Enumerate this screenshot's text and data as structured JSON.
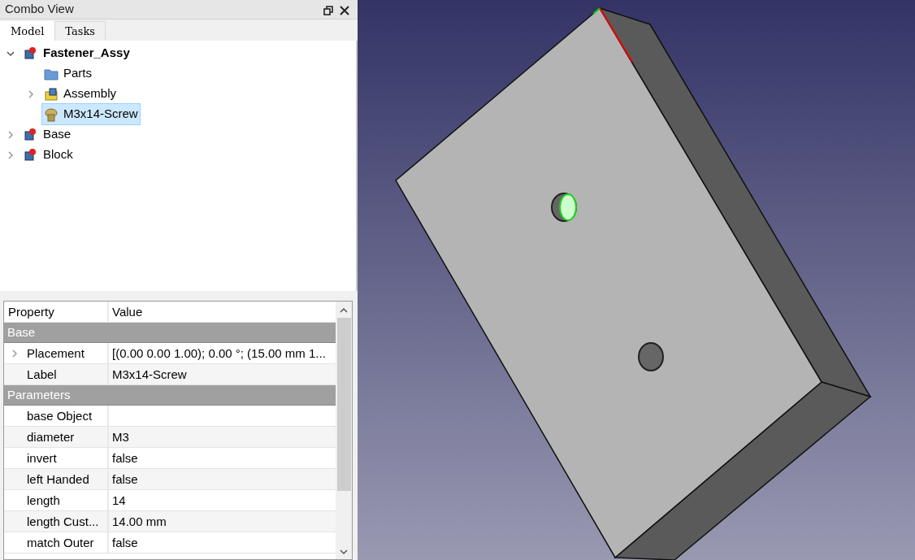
{
  "panel": {
    "title": "Combo View"
  },
  "tabs": [
    {
      "label": "Model",
      "selected": true
    },
    {
      "label": "Tasks",
      "selected": false
    }
  ],
  "tree": [
    {
      "label": "Fastener_Assy",
      "kind": "part",
      "bold": true,
      "expanded": true,
      "selected": false,
      "children": [
        {
          "label": "Parts",
          "kind": "folder",
          "bold": false,
          "selected": false
        },
        {
          "label": "Assembly",
          "kind": "assembly",
          "bold": false,
          "expanded": false,
          "selected": false
        },
        {
          "label": "M3x14-Screw",
          "kind": "screw",
          "bold": false,
          "selected": true
        }
      ]
    },
    {
      "label": "Base",
      "kind": "part",
      "bold": false,
      "expanded": false,
      "selected": false
    },
    {
      "label": "Block",
      "kind": "part",
      "bold": false,
      "expanded": false,
      "selected": false
    }
  ],
  "properties": {
    "columns": [
      "Property",
      "Value"
    ],
    "groups": [
      {
        "name": "Base",
        "rows": [
          {
            "property": "Placement",
            "value": "[(0.00 0.00 1.00); 0.00 °; (15.00 mm  1...",
            "expanded": false
          },
          {
            "property": "Label",
            "value": "M3x14-Screw"
          }
        ]
      },
      {
        "name": "Parameters",
        "rows": [
          {
            "property": "base Object",
            "value": ""
          },
          {
            "property": "diameter",
            "value": "M3"
          },
          {
            "property": "invert",
            "value": "false"
          },
          {
            "property": "left Handed",
            "value": "false"
          },
          {
            "property": "length",
            "value": "14"
          },
          {
            "property": "length Cust...",
            "value": "14.00 mm"
          },
          {
            "property": "match Outer",
            "value": "false"
          }
        ]
      }
    ]
  }
}
